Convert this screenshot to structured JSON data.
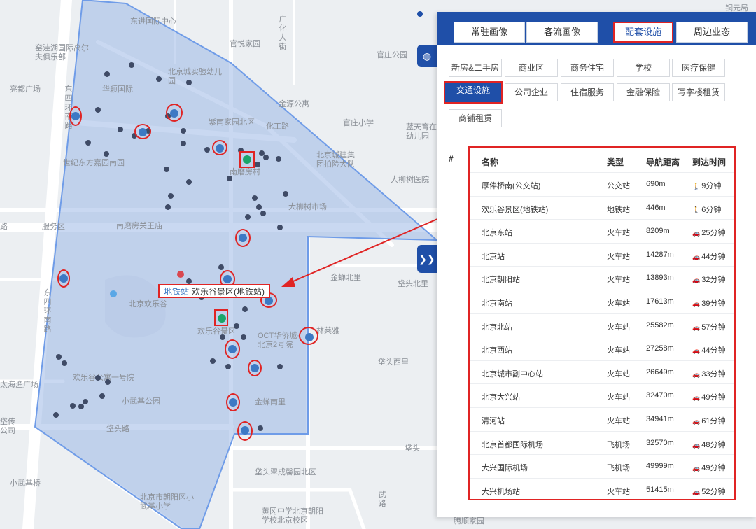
{
  "tabs": [
    {
      "label": "常驻画像",
      "active": false
    },
    {
      "label": "客流画像",
      "active": false
    },
    {
      "label": "配套设施",
      "active": true
    },
    {
      "label": "周边业态",
      "active": false
    }
  ],
  "categories": [
    {
      "label": "新房&二手房",
      "active": false
    },
    {
      "label": "商业区",
      "active": false
    },
    {
      "label": "商务住宅",
      "active": false
    },
    {
      "label": "学校",
      "active": false
    },
    {
      "label": "医疗保健",
      "active": false
    },
    {
      "label": "交通设施",
      "active": true
    },
    {
      "label": "公司企业",
      "active": false
    },
    {
      "label": "住宿服务",
      "active": false
    },
    {
      "label": "金融保险",
      "active": false
    },
    {
      "label": "写字楼租赁",
      "active": false
    },
    {
      "label": "商铺租赁",
      "active": false
    }
  ],
  "table": {
    "hash": "#",
    "headers": {
      "name": "名称",
      "type": "类型",
      "distance": "导航距离",
      "time": "到达时间"
    },
    "rows": [
      {
        "name": "厚俸桥南(公交站)",
        "type": "公交站",
        "distance": "690m",
        "mode": "walk",
        "time": "9分钟"
      },
      {
        "name": "欢乐谷景区(地铁站)",
        "type": "地铁站",
        "distance": "446m",
        "mode": "walk",
        "time": "6分钟"
      },
      {
        "name": "北京东站",
        "type": "火车站",
        "distance": "8209m",
        "mode": "car",
        "time": "25分钟"
      },
      {
        "name": "北京站",
        "type": "火车站",
        "distance": "14287m",
        "mode": "car",
        "time": "44分钟"
      },
      {
        "name": "北京朝阳站",
        "type": "火车站",
        "distance": "13893m",
        "mode": "car",
        "time": "32分钟"
      },
      {
        "name": "北京南站",
        "type": "火车站",
        "distance": "17613m",
        "mode": "car",
        "time": "39分钟"
      },
      {
        "name": "北京北站",
        "type": "火车站",
        "distance": "25582m",
        "mode": "car",
        "time": "57分钟"
      },
      {
        "name": "北京西站",
        "type": "火车站",
        "distance": "27258m",
        "mode": "car",
        "time": "44分钟"
      },
      {
        "name": "北京城市副中心站",
        "type": "火车站",
        "distance": "26649m",
        "mode": "car",
        "time": "33分钟"
      },
      {
        "name": "北京大兴站",
        "type": "火车站",
        "distance": "32470m",
        "mode": "car",
        "time": "49分钟"
      },
      {
        "name": "清河站",
        "type": "火车站",
        "distance": "34941m",
        "mode": "car",
        "time": "61分钟"
      },
      {
        "name": "北京首都国际机场",
        "type": "飞机场",
        "distance": "32570m",
        "mode": "car",
        "time": "48分钟"
      },
      {
        "name": "大兴国际机场",
        "type": "飞机场",
        "distance": "49999m",
        "mode": "car",
        "time": "49分钟"
      },
      {
        "name": "大兴机场站",
        "type": "火车站",
        "distance": "51415m",
        "mode": "car",
        "time": "52分钟"
      }
    ]
  },
  "map_tooltip": {
    "kind": "地铁站",
    "name": "欢乐谷景区(地铁站)"
  },
  "map_labels": [
    "东进国际中心",
    "官悦家园",
    "广化大街",
    "北京城实验幼儿园",
    "华颖国际",
    "官庄公园",
    "窑洼湖国际高尔夫俱乐部",
    "亮都广场",
    "金源公寓",
    "紫南家园北区",
    "化工路",
    "官庄小学",
    "蓝天育在中心幼儿园",
    "世纪东方嘉园南园",
    "南磨房村",
    "北京城建集团拍险大队",
    "大柳树医院",
    "大柳树市场",
    "服务区",
    "南磨房关王庙",
    "金蝉北里",
    "垡头北里",
    "北京欢乐谷",
    "欢乐谷景区",
    "OCT华侨城·北京2号院",
    "林莱雅",
    "垡头西里",
    "欢乐谷公寓一号院",
    "小武基公园",
    "垡头路",
    "金蝉南里",
    "垡头",
    "垡头翠成馨园北区",
    "小武基桥",
    "北京市朝阳区小武基小学",
    "黄冈中学北京朝阳学校北京校区",
    "武路",
    "腾顺家园",
    "东四环南路",
    "东四环南路",
    "路",
    "太海渔广场",
    "垡传公司",
    "铜元局"
  ],
  "map_side_buttons": {
    "top": "◍",
    "expand": "❯❯"
  }
}
